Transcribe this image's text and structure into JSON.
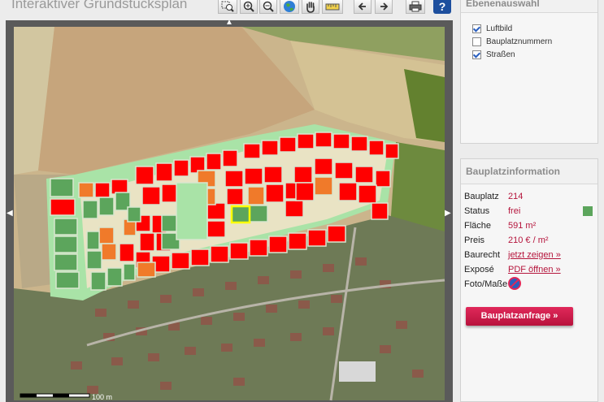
{
  "app": {
    "title": "Interaktiver Grundstücksplan"
  },
  "toolbar": {
    "icons": [
      "zoom-rect-icon",
      "zoom-in-icon",
      "zoom-out-icon",
      "globe-icon",
      "pan-hand-icon",
      "measure-ruler-icon",
      "back-arrow-icon",
      "forward-arrow-icon",
      "print-icon",
      "help-icon"
    ],
    "help_label": "?"
  },
  "map": {
    "scale_label": "100 m",
    "plot_status_colors": {
      "frei": "#5ca55c",
      "reserviert": "#f07a2a",
      "verkauft": "#ff0000",
      "selected_outline": "#ffff00"
    }
  },
  "layers": {
    "title": "Ebenenauswahl",
    "items": [
      {
        "label": "Luftbild",
        "checked": true
      },
      {
        "label": "Bauplatznummern",
        "checked": false
      },
      {
        "label": "Straßen",
        "checked": true
      }
    ]
  },
  "info": {
    "title": "Bauplatzinformation",
    "rows": [
      {
        "key": "Bauplatz",
        "value": "214"
      },
      {
        "key": "Status",
        "value": "frei",
        "color": "#5ca55c"
      },
      {
        "key": "Fläche",
        "value": "591 m²"
      },
      {
        "key": "Preis",
        "value": "210 € / m²"
      },
      {
        "key": "Baurecht",
        "value": "jetzt zeigen »"
      },
      {
        "key": "Exposé",
        "value": "PDF öffnen »"
      },
      {
        "key": "Foto/Maße",
        "value": "no-photo-icon"
      }
    ],
    "button_label": "Bauplatzanfrage »"
  }
}
